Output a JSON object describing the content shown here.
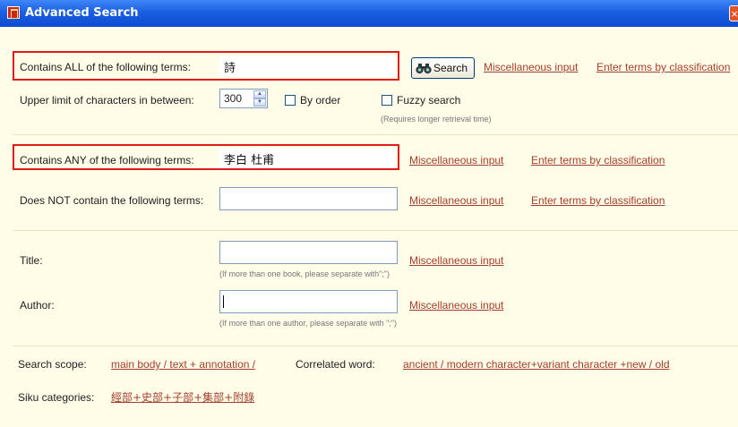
{
  "window": {
    "title": "Advanced Search",
    "close_glyph": "×"
  },
  "all_terms": {
    "label": "Contains ALL of the following terms:",
    "value": "詩",
    "search_label": "Search",
    "misc_link": "Miscellaneous input",
    "classify_link": "Enter terms by classification"
  },
  "limit": {
    "label": "Upper limit of characters in between:",
    "value": "300",
    "by_order": "By order",
    "fuzzy": "Fuzzy search",
    "fuzzy_note": "(Requires longer retrieval time)"
  },
  "any_terms": {
    "label": "Contains ANY of the following terms:",
    "value": "李白 杜甫",
    "misc_link": "Miscellaneous input",
    "classify_link": "Enter terms by classification"
  },
  "not_terms": {
    "label": "Does NOT contain the following terms:",
    "value": "",
    "misc_link": "Miscellaneous input",
    "classify_link": "Enter terms by classification"
  },
  "title_field": {
    "label": "Title:",
    "value": "",
    "misc_link": "Miscellaneous input",
    "note": "(If more than one book, please separate with\";\")"
  },
  "author_field": {
    "label": "Author:",
    "value": "",
    "misc_link": "Miscellaneous input",
    "note": "(If more than one author, please separate with \";\")"
  },
  "scope": {
    "label": "Search scope:",
    "link": "main body / text + annotation /",
    "correlated_label": "Correlated word:",
    "correlated_link": "ancient / modern character+variant character +new / old"
  },
  "siku": {
    "label": "Siku categories:",
    "link": "經部+史部+子部+集部+附錄"
  },
  "colors": {
    "titlebar": "#1b5fe2",
    "highlight": "#e11b1b",
    "link": "#a3402f",
    "panel": "#fffce8"
  }
}
